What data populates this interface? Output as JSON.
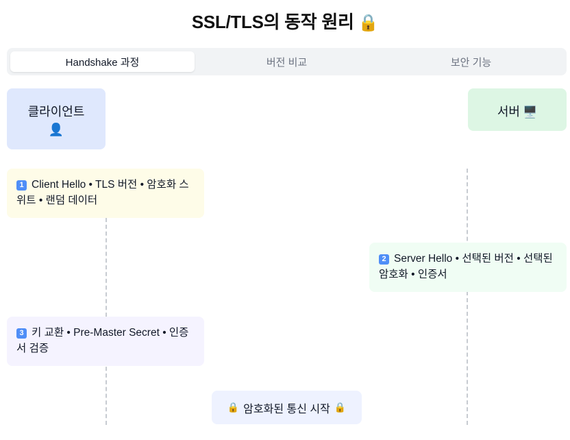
{
  "title": "SSL/TLS의 동작 원리",
  "title_icon": "🔒",
  "tabs": [
    {
      "label": "Handshake 과정",
      "active": true
    },
    {
      "label": "버전 비교",
      "active": false
    },
    {
      "label": "보안 기능",
      "active": false
    }
  ],
  "client": {
    "label": "클라이언트",
    "icon": "👤"
  },
  "server": {
    "label": "서버",
    "icon": "🖥️"
  },
  "messages": [
    {
      "number": "1",
      "text": "Client Hello • TLS 버전 • 암호화 스위트 • 랜덤 데이터"
    },
    {
      "number": "2",
      "text": "Server Hello • 선택된 버전 • 선택된 암호화 • 인증서"
    },
    {
      "number": "3",
      "text": "키 교환 • Pre-Master Secret • 인증서 검증"
    }
  ],
  "final": {
    "text": "암호화된 통신 시작",
    "icon": "🔒"
  },
  "colors": {
    "client_bg": "#dfe8fd",
    "server_bg": "#ddf6e4",
    "msg1_bg": "#fefce8",
    "msg2_bg": "#f0fdf4",
    "msg3_bg": "#f5f3ff",
    "number_badge": "#4f8ef7"
  }
}
